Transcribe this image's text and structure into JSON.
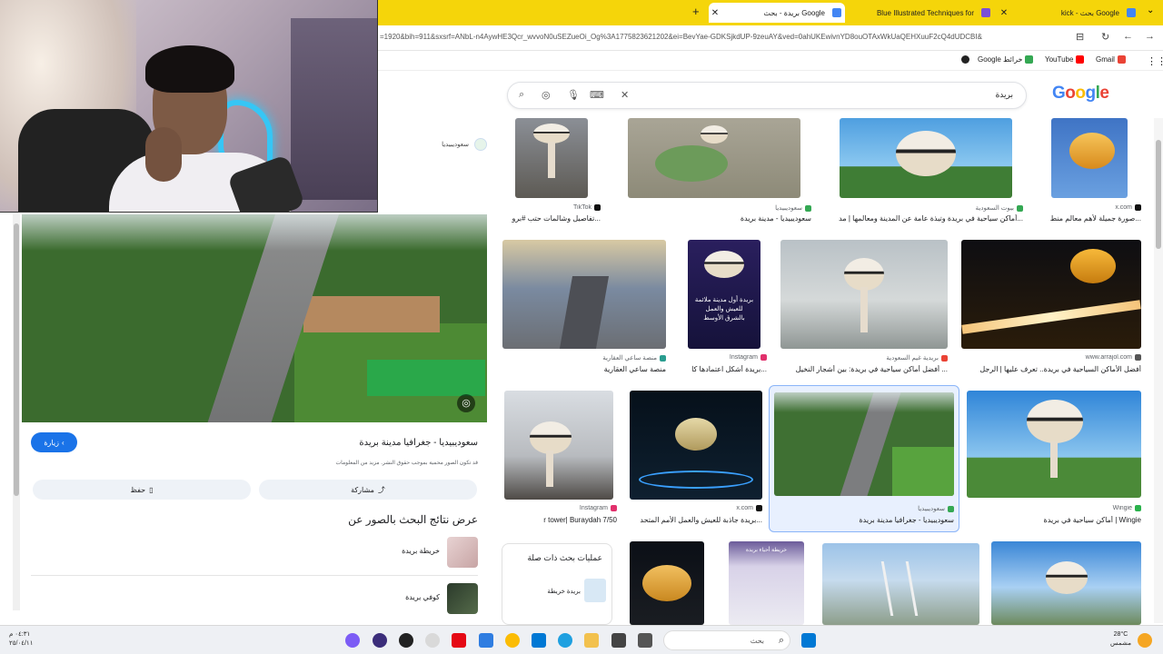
{
  "browser": {
    "tabs": [
      {
        "title": "kick - بحث Google",
        "favicon_color": "#4285f4"
      },
      {
        "title": "Blue Illustrated Techniques for",
        "favicon_color": "#7b4fd6"
      },
      {
        "title": "بريدة - بحث Google",
        "favicon_color": "#4285f4"
      }
    ],
    "new_tab": "+",
    "close": "✕",
    "url": "=1920&bih=911&sxsrf=ANbL-n4AywHE3Qcr_wvvoN0uSEZueOi_Og%3A1775823621202&ei=BevYae-GDKSjkdUP-9zeuAY&ved=0ahUKEwivnYD8ouOTAxWkUaQEHXuuF2cQ4dUDCBI&",
    "bookmarks": [
      {
        "label": "Gmail",
        "color": "#ea4335"
      },
      {
        "label": "YouTube",
        "color": "#ff0000"
      },
      {
        "label": "Google خرائط",
        "color": "#34a853"
      }
    ]
  },
  "search": {
    "query": "بريدة",
    "logo": "Google",
    "logo_colors": [
      "#4285f4",
      "#ea4335",
      "#fbbc05",
      "#4285f4",
      "#34a853",
      "#ea4335"
    ]
  },
  "preview": {
    "source_name": "سعوديبيديا",
    "visit_label": "زيارة",
    "title": "سعوديبيديا - جغرافيا مدينة بريدة",
    "copyright": "قد تكون الصور محمية بموجب حقوق النشر. مزيد من المعلومات",
    "share_label": "مشاركة",
    "save_label": "حفظ",
    "related_heading": "عرض نتائج البحث بالصور عن",
    "related": [
      {
        "label": "خريطة بريدة"
      },
      {
        "label": "كوفي بريدة"
      }
    ]
  },
  "grid": [
    {
      "source": "TikTok",
      "title": "تفاصيل وشالمات حتب #برو..."
    },
    {
      "source": "سعوديبيديا",
      "title": "سعوديبيديا - مدينة بريدة"
    },
    {
      "source": "بيوت السعودية",
      "title": "أماكن سياحية في بريدة وتبذة عامة عن المدينة ومعالمها | مد..."
    },
    {
      "source": "x.com",
      "title": "صورة جميلة لأهم معالم منط..."
    },
    {
      "source": "منصة ساعي العقارية",
      "title": "منصة ساعي العقارية"
    },
    {
      "source": "Instagram",
      "title": "بريدة أشكل اعتمادها كا..."
    },
    {
      "source": "بريدية غيم السعودية",
      "title": "أفضل أماكن سياحية في بريدة: بين أشجار النخيل ..."
    },
    {
      "source": "www.arrajol.com",
      "title": "أفضل الأماكن السياحية في بريدة.. تعرف عليها | الرجل"
    },
    {
      "source": "Instagram",
      "title": "r tower| Buraydah 7/50"
    },
    {
      "source": "x.com",
      "title": "بريدة جاذبة للعيش والعمل الأمم المتحد..."
    },
    {
      "source": "سعوديبيديا",
      "title": "سعوديبيديا - جغرافيا مدينة بريدة"
    },
    {
      "source": "Wingie",
      "title": "أماكن سياحية في بريدة | Wingie"
    }
  ],
  "badges": {
    "ad_line1": "بريدة أول مدينة ملائمة",
    "ad_line2": "للعيش والعمل",
    "ad_line3": "بالشرق الأوسط",
    "map_label": "خريطة أحياء بريدة"
  },
  "related_searches": {
    "heading": "عمليات بحث ذات صلة",
    "item": "بريدة خريطة"
  },
  "taskbar": {
    "time": "٠٤:٣١ م",
    "date": "٢٥/٠٤/١١",
    "search_placeholder": "بحث",
    "temp": "28°C",
    "weather": "مشمس"
  }
}
